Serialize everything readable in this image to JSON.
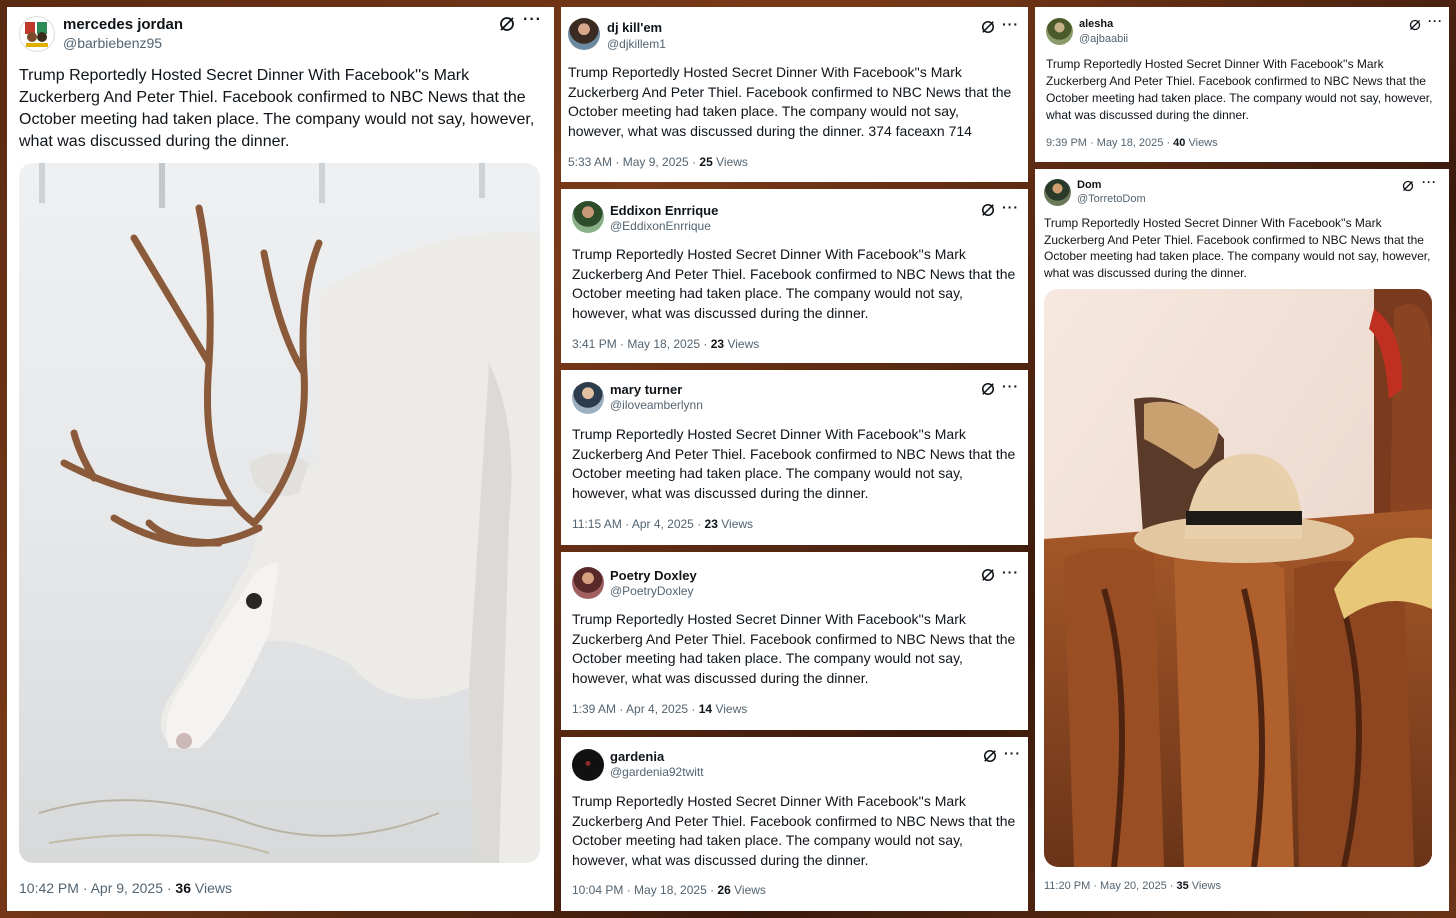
{
  "tweets": [
    {
      "name": "mercedes jordan",
      "handle": "@barbiebenz95",
      "text": "Trump Reportedly Hosted Secret Dinner With Facebook''s Mark Zuckerberg And Peter Thiel. Facebook confirmed to NBC News that the October meeting had taken place. The company would not say, however, what was discussed during the dinner.",
      "time": "10:42 PM · Apr 9, 2025 · ",
      "views_count": "36",
      "views_label": "Views",
      "image": "white reindeer with antlers grazing in snow"
    },
    {
      "name": "dj kill'em",
      "handle": "@djkillem1",
      "text": "Trump Reportedly Hosted Secret Dinner With Facebook''s Mark Zuckerberg And Peter Thiel. Facebook confirmed to NBC News that the October meeting had taken place. The company would not say, however, what was discussed during the dinner. 374 faceaxn 714",
      "time": "5:33 AM · May 9, 2025 · ",
      "views_count": "25",
      "views_label": "Views"
    },
    {
      "name": "Eddixon Enrrique",
      "handle": "@EddixonEnrrique",
      "text": "Trump Reportedly Hosted Secret Dinner With Facebook''s Mark Zuckerberg And Peter Thiel. Facebook confirmed to NBC News that the October meeting had taken place. The company would not say, however, what was discussed during the dinner.",
      "time": "3:41 PM · May 18, 2025 · ",
      "views_count": "23",
      "views_label": "Views"
    },
    {
      "name": "mary turner",
      "handle": "@iloveamberlynn",
      "text": "Trump Reportedly Hosted Secret Dinner With Facebook''s Mark Zuckerberg And Peter Thiel. Facebook confirmed to NBC News that the October meeting had taken place. The company would not say, however, what was discussed during the dinner.",
      "time": "11:15 AM · Apr 4, 2025 · ",
      "views_count": "23",
      "views_label": "Views"
    },
    {
      "name": "Poetry Doxley",
      "handle": "@PoetryDoxley",
      "text": "Trump Reportedly Hosted Secret Dinner With Facebook''s Mark Zuckerberg And Peter Thiel. Facebook confirmed to NBC News that the October meeting had taken place. The company would not say, however, what was discussed during the dinner.",
      "time": "1:39 AM · Apr 4, 2025 · ",
      "views_count": "14",
      "views_label": "Views"
    },
    {
      "name": "gardenia",
      "handle": "@gardenia92twitt",
      "text": "Trump Reportedly Hosted Secret Dinner With Facebook''s Mark Zuckerberg And Peter Thiel. Facebook confirmed to NBC News that the October meeting had taken place. The company would not say, however, what was discussed during the dinner.",
      "time": "10:04 PM · May 18, 2025 · ",
      "views_count": "26",
      "views_label": "Views"
    },
    {
      "name": "alesha",
      "handle": "@ajbaabii",
      "text": "Trump Reportedly Hosted Secret Dinner With Facebook''s Mark Zuckerberg And Peter Thiel. Facebook confirmed to NBC News that the October meeting had taken place. The company would not say, however, what was discussed during the dinner.",
      "time": "9:39 PM · May 18, 2025 · ",
      "views_count": "40",
      "views_label": "Views"
    },
    {
      "name": "Dom",
      "handle": "@TorretoDom",
      "text": "Trump Reportedly Hosted Secret Dinner With Facebook''s Mark Zuckerberg And Peter Thiel. Facebook confirmed to NBC News that the October meeting had taken place. The company would not say, however, what was discussed during the dinner.",
      "time": "11:20 PM · May 20, 2025 · ",
      "views_count": "35",
      "views_label": "Views",
      "image": "saddles and leather tack with a straw hat"
    }
  ],
  "icons": {
    "grok": "grok-icon",
    "more": "more-options-icon"
  },
  "colors": {
    "name": "#0f1419",
    "secondary": "#536471",
    "frame": "#5a2a12"
  }
}
